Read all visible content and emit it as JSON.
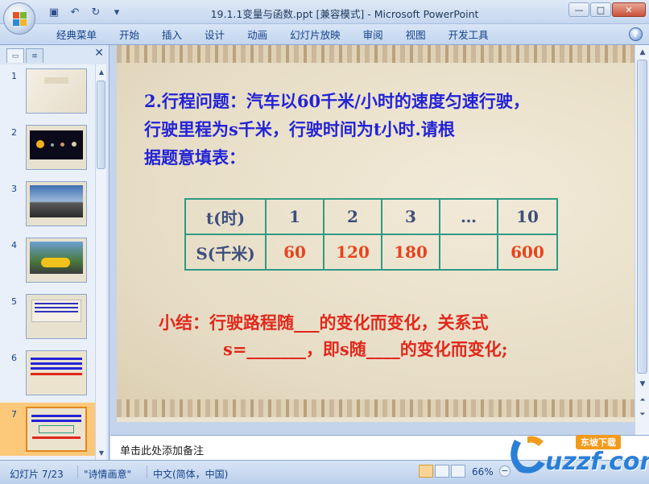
{
  "window": {
    "title": "19.1.1变量与函数.ppt [兼容模式] - Microsoft PowerPoint",
    "minimize_glyph": "—",
    "maximize_glyph": "□",
    "close_glyph": "✕"
  },
  "quick_access": [
    {
      "icon": "save-icon",
      "glyph": "▣"
    },
    {
      "icon": "undo-icon",
      "glyph": "↶"
    },
    {
      "icon": "redo-icon",
      "glyph": "↻"
    },
    {
      "icon": "customize-icon",
      "glyph": "▾"
    }
  ],
  "ribbon": {
    "tabs": [
      "经典菜单",
      "开始",
      "插入",
      "设计",
      "动画",
      "幻灯片放映",
      "审阅",
      "视图",
      "开发工具"
    ],
    "help_glyph": "?"
  },
  "panel": {
    "close_glyph": "✕",
    "slides": [
      {
        "num": "1"
      },
      {
        "num": "2"
      },
      {
        "num": "3"
      },
      {
        "num": "4"
      },
      {
        "num": "5"
      },
      {
        "num": "6"
      },
      {
        "num": "7"
      }
    ],
    "selected": 7
  },
  "slide": {
    "question": [
      "2.行程问题：汽车以60千米/小时的速度匀速行驶，",
      "行驶里程为s千米，行驶时间为t小时.请根",
      "据题意填表："
    ],
    "table": {
      "row1": [
        "t(时)",
        "1",
        "2",
        "3",
        "…",
        "10"
      ],
      "row2": [
        "S(千米)",
        "60",
        "120",
        "180",
        "",
        "600"
      ]
    },
    "summary_line1": "小结：行驶路程随___的变化而变化，关系式",
    "summary_line2": "s=_______，即s随____的变化而变化;"
  },
  "notes": {
    "placeholder": "单击此处添加备注"
  },
  "status": {
    "slide_info": "幻灯片 7/23",
    "theme": "\"诗情画意\"",
    "language": "中文(简体，中国)",
    "zoom": "66%",
    "zoom_minus": "−"
  },
  "watermark": {
    "brand": "uzzf.com",
    "tagline": "东坡下载"
  }
}
